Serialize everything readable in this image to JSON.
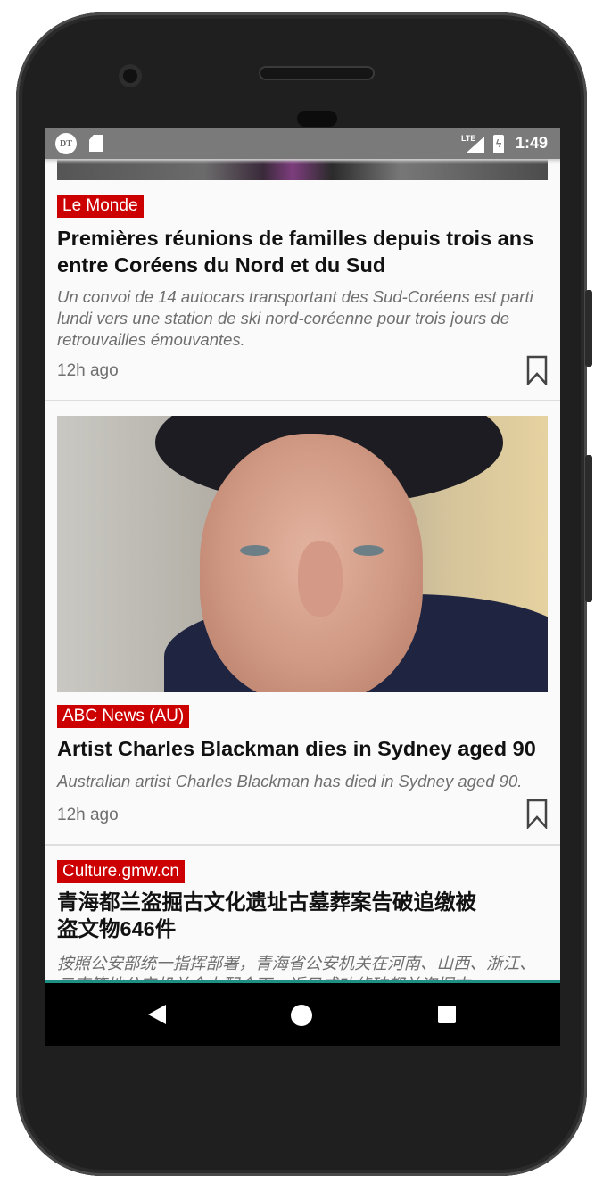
{
  "status_bar": {
    "app_badge": "DT",
    "network": "LTE",
    "time": "1:49"
  },
  "feed": {
    "items": [
      {
        "source": "Le Monde",
        "headline": "Premières réunions de familles depuis trois ans entre Coréens du Nord et du Sud",
        "summary": "Un convoi de 14 autocars transportant des Sud-Coréens est parti lundi vers une station de ski nord-coréenne pour trois jours de retrouvailles émouvantes.",
        "time": "12h ago"
      },
      {
        "source": "ABC News (AU)",
        "headline": "Artist Charles Blackman dies in Sydney aged 90",
        "summary": "Australian artist Charles Blackman has died in Sydney aged 90.",
        "time": "12h ago"
      },
      {
        "source": "Culture.gmw.cn",
        "headline": "青海都兰盗掘古文化遗址古墓葬案告破追缴被盗文物646件",
        "summary": "按照公安部统一指挥部署，青海省公安机关在河南、山西、浙江、云南等地公安机关全力配合下，近日成功侦破都兰盗掘古"
      }
    ]
  },
  "colors": {
    "source_badge": "#cc0000",
    "status_bar": "#7a7a7a",
    "accent_line": "#1f8f86"
  },
  "icons": {
    "bookmark": "bookmark-icon",
    "back": "back-icon",
    "home": "home-icon",
    "recents": "recents-icon"
  }
}
